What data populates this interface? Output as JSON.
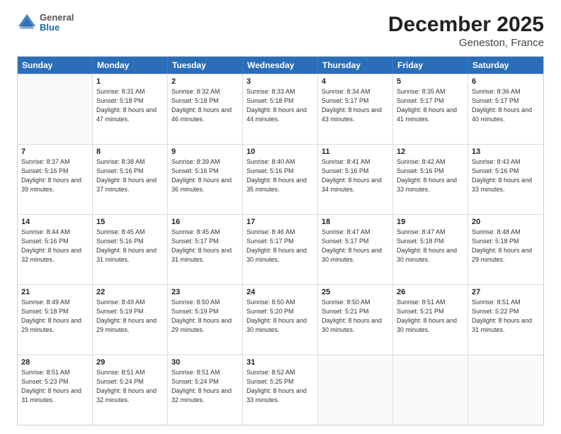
{
  "header": {
    "logo": {
      "general": "General",
      "blue": "Blue"
    },
    "title": "December 2025",
    "location": "Geneston, France"
  },
  "weekdays": [
    "Sunday",
    "Monday",
    "Tuesday",
    "Wednesday",
    "Thursday",
    "Friday",
    "Saturday"
  ],
  "weeks": [
    [
      {
        "day": "",
        "empty": true
      },
      {
        "day": "1",
        "sunrise": "Sunrise: 8:31 AM",
        "sunset": "Sunset: 5:18 PM",
        "daylight": "Daylight: 8 hours and 47 minutes."
      },
      {
        "day": "2",
        "sunrise": "Sunrise: 8:32 AM",
        "sunset": "Sunset: 5:18 PM",
        "daylight": "Daylight: 8 hours and 46 minutes."
      },
      {
        "day": "3",
        "sunrise": "Sunrise: 8:33 AM",
        "sunset": "Sunset: 5:18 PM",
        "daylight": "Daylight: 8 hours and 44 minutes."
      },
      {
        "day": "4",
        "sunrise": "Sunrise: 8:34 AM",
        "sunset": "Sunset: 5:17 PM",
        "daylight": "Daylight: 8 hours and 43 minutes."
      },
      {
        "day": "5",
        "sunrise": "Sunrise: 8:35 AM",
        "sunset": "Sunset: 5:17 PM",
        "daylight": "Daylight: 8 hours and 41 minutes."
      },
      {
        "day": "6",
        "sunrise": "Sunrise: 8:36 AM",
        "sunset": "Sunset: 5:17 PM",
        "daylight": "Daylight: 8 hours and 40 minutes."
      }
    ],
    [
      {
        "day": "7",
        "sunrise": "Sunrise: 8:37 AM",
        "sunset": "Sunset: 5:16 PM",
        "daylight": "Daylight: 8 hours and 39 minutes."
      },
      {
        "day": "8",
        "sunrise": "Sunrise: 8:38 AM",
        "sunset": "Sunset: 5:16 PM",
        "daylight": "Daylight: 8 hours and 37 minutes."
      },
      {
        "day": "9",
        "sunrise": "Sunrise: 8:39 AM",
        "sunset": "Sunset: 5:16 PM",
        "daylight": "Daylight: 8 hours and 36 minutes."
      },
      {
        "day": "10",
        "sunrise": "Sunrise: 8:40 AM",
        "sunset": "Sunset: 5:16 PM",
        "daylight": "Daylight: 8 hours and 35 minutes."
      },
      {
        "day": "11",
        "sunrise": "Sunrise: 8:41 AM",
        "sunset": "Sunset: 5:16 PM",
        "daylight": "Daylight: 8 hours and 34 minutes."
      },
      {
        "day": "12",
        "sunrise": "Sunrise: 8:42 AM",
        "sunset": "Sunset: 5:16 PM",
        "daylight": "Daylight: 8 hours and 33 minutes."
      },
      {
        "day": "13",
        "sunrise": "Sunrise: 8:43 AM",
        "sunset": "Sunset: 5:16 PM",
        "daylight": "Daylight: 8 hours and 33 minutes."
      }
    ],
    [
      {
        "day": "14",
        "sunrise": "Sunrise: 8:44 AM",
        "sunset": "Sunset: 5:16 PM",
        "daylight": "Daylight: 8 hours and 32 minutes."
      },
      {
        "day": "15",
        "sunrise": "Sunrise: 8:45 AM",
        "sunset": "Sunset: 5:16 PM",
        "daylight": "Daylight: 8 hours and 31 minutes."
      },
      {
        "day": "16",
        "sunrise": "Sunrise: 8:45 AM",
        "sunset": "Sunset: 5:17 PM",
        "daylight": "Daylight: 8 hours and 31 minutes."
      },
      {
        "day": "17",
        "sunrise": "Sunrise: 8:46 AM",
        "sunset": "Sunset: 5:17 PM",
        "daylight": "Daylight: 8 hours and 30 minutes."
      },
      {
        "day": "18",
        "sunrise": "Sunrise: 8:47 AM",
        "sunset": "Sunset: 5:17 PM",
        "daylight": "Daylight: 8 hours and 30 minutes."
      },
      {
        "day": "19",
        "sunrise": "Sunrise: 8:47 AM",
        "sunset": "Sunset: 5:18 PM",
        "daylight": "Daylight: 8 hours and 30 minutes."
      },
      {
        "day": "20",
        "sunrise": "Sunrise: 8:48 AM",
        "sunset": "Sunset: 5:18 PM",
        "daylight": "Daylight: 8 hours and 29 minutes."
      }
    ],
    [
      {
        "day": "21",
        "sunrise": "Sunrise: 8:49 AM",
        "sunset": "Sunset: 5:18 PM",
        "daylight": "Daylight: 8 hours and 29 minutes."
      },
      {
        "day": "22",
        "sunrise": "Sunrise: 8:49 AM",
        "sunset": "Sunset: 5:19 PM",
        "daylight": "Daylight: 8 hours and 29 minutes."
      },
      {
        "day": "23",
        "sunrise": "Sunrise: 8:50 AM",
        "sunset": "Sunset: 5:19 PM",
        "daylight": "Daylight: 8 hours and 29 minutes."
      },
      {
        "day": "24",
        "sunrise": "Sunrise: 8:50 AM",
        "sunset": "Sunset: 5:20 PM",
        "daylight": "Daylight: 8 hours and 30 minutes."
      },
      {
        "day": "25",
        "sunrise": "Sunrise: 8:50 AM",
        "sunset": "Sunset: 5:21 PM",
        "daylight": "Daylight: 8 hours and 30 minutes."
      },
      {
        "day": "26",
        "sunrise": "Sunrise: 8:51 AM",
        "sunset": "Sunset: 5:21 PM",
        "daylight": "Daylight: 8 hours and 30 minutes."
      },
      {
        "day": "27",
        "sunrise": "Sunrise: 8:51 AM",
        "sunset": "Sunset: 5:22 PM",
        "daylight": "Daylight: 8 hours and 31 minutes."
      }
    ],
    [
      {
        "day": "28",
        "sunrise": "Sunrise: 8:51 AM",
        "sunset": "Sunset: 5:23 PM",
        "daylight": "Daylight: 8 hours and 31 minutes."
      },
      {
        "day": "29",
        "sunrise": "Sunrise: 8:51 AM",
        "sunset": "Sunset: 5:24 PM",
        "daylight": "Daylight: 8 hours and 32 minutes."
      },
      {
        "day": "30",
        "sunrise": "Sunrise: 8:51 AM",
        "sunset": "Sunset: 5:24 PM",
        "daylight": "Daylight: 8 hours and 32 minutes."
      },
      {
        "day": "31",
        "sunrise": "Sunrise: 8:52 AM",
        "sunset": "Sunset: 5:25 PM",
        "daylight": "Daylight: 8 hours and 33 minutes."
      },
      {
        "day": "",
        "empty": true
      },
      {
        "day": "",
        "empty": true
      },
      {
        "day": "",
        "empty": true
      }
    ]
  ]
}
